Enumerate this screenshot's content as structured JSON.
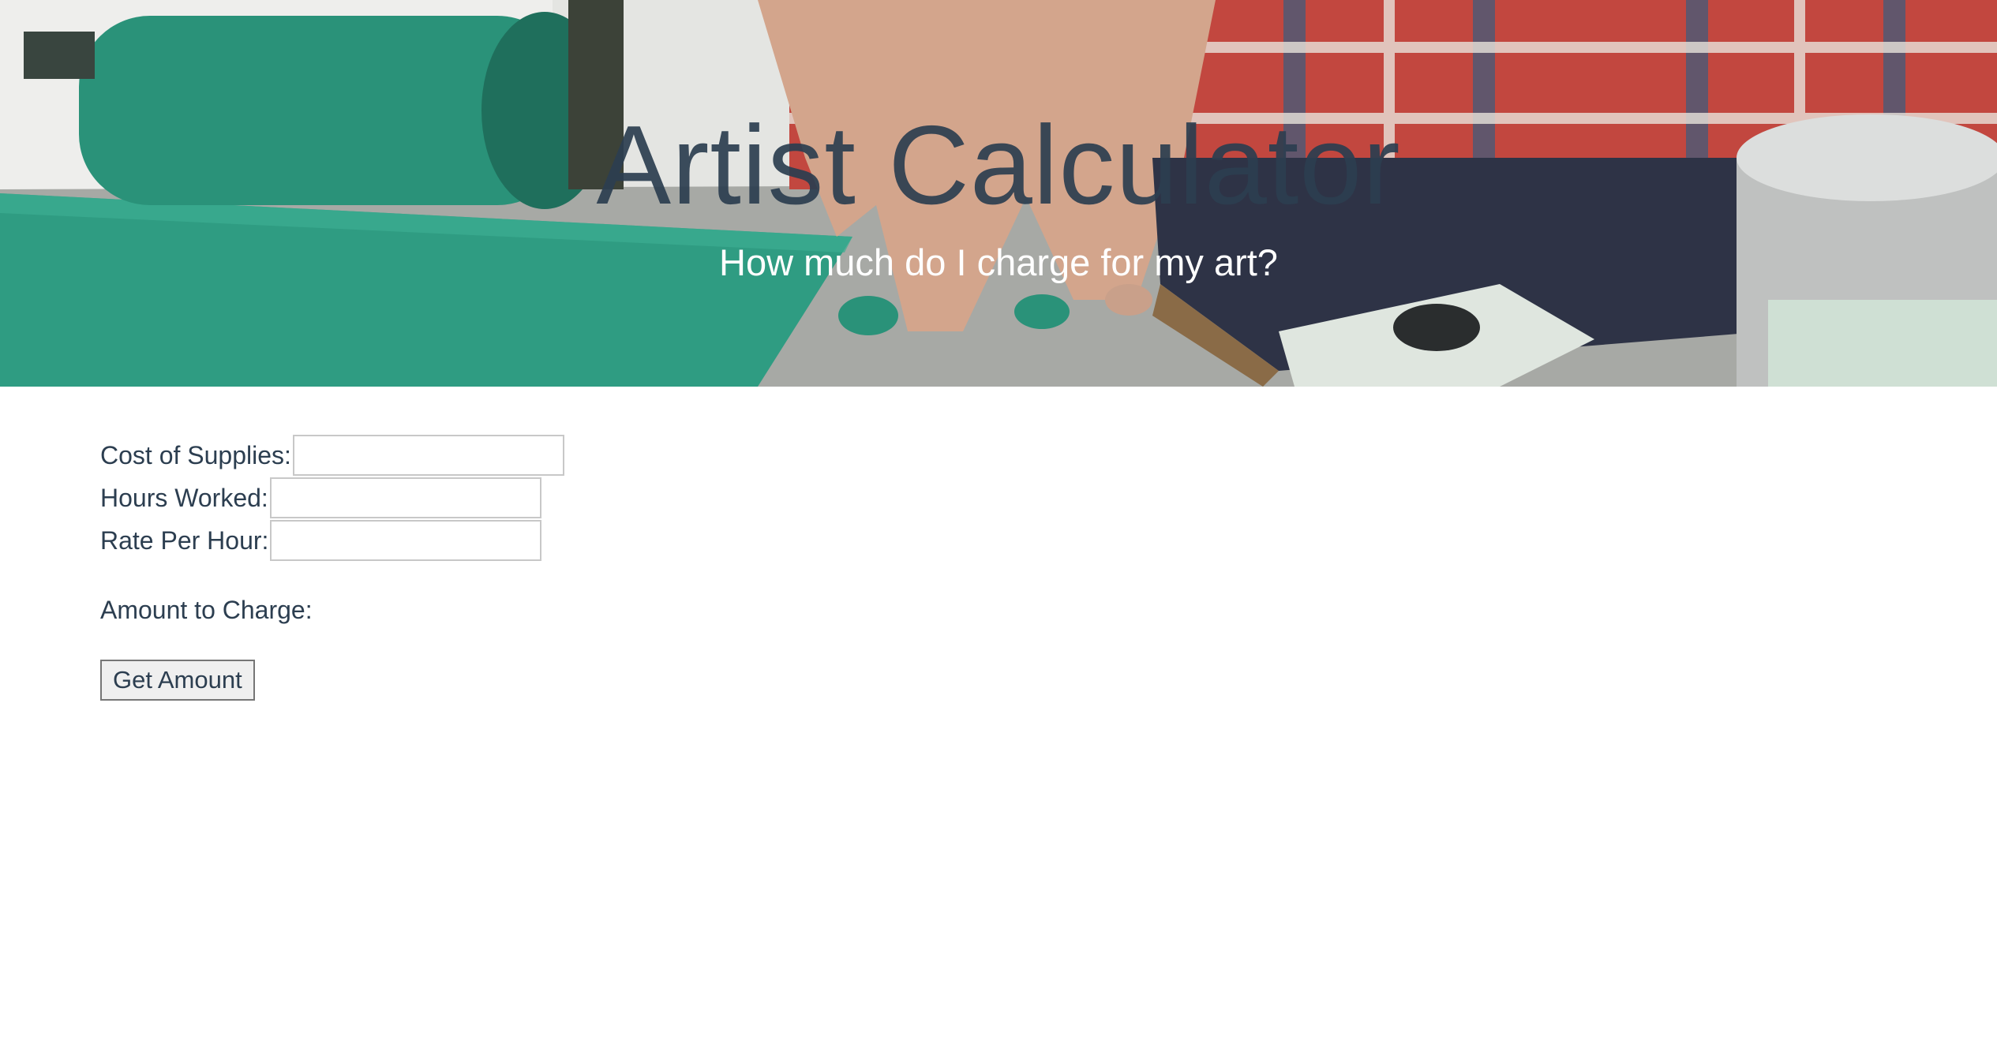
{
  "hero": {
    "title": "Artist Calculator",
    "subtitle": "How much do I charge for my art?",
    "image_icon": "printmaking-photo"
  },
  "form": {
    "supplies_label": "Cost of Supplies:",
    "supplies_value": "",
    "hours_label": "Hours Worked:",
    "hours_value": "",
    "rate_label": "Rate Per Hour:",
    "rate_value": "",
    "amount_label": "Amount to Charge:",
    "amount_value": "",
    "button_label": "Get Amount"
  },
  "colors": {
    "text": "#2c3e50",
    "subtitle": "#ffffff",
    "roller_green": "#2b9c80",
    "background": "#ffffff"
  }
}
